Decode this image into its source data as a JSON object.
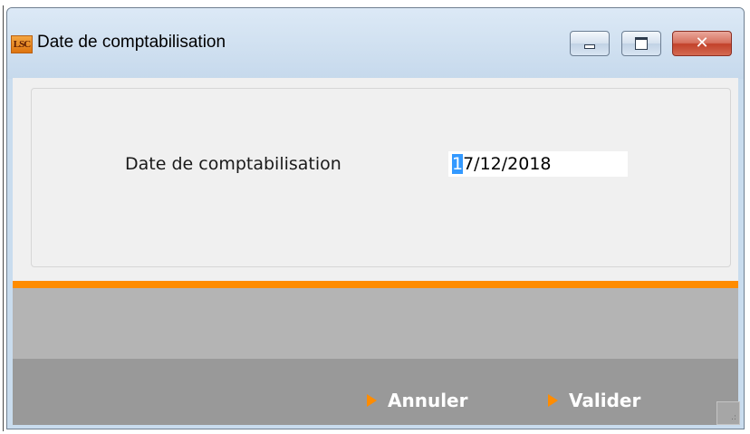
{
  "window": {
    "app_icon_text": "LSC",
    "title": "Date de comptabilisation",
    "controls": {
      "minimize": "minimize-icon",
      "maximize": "maximize-icon",
      "close": "close-icon",
      "close_glyph": "✕"
    }
  },
  "form": {
    "date_label": "Date de comptabilisation",
    "date_value": "17/12/2018",
    "date_selected_char": "1",
    "date_rest": "7/12/2018"
  },
  "actions": {
    "cancel_label": "Annuler",
    "ok_label": "Valider"
  },
  "colors": {
    "accent": "#ff8c00",
    "footer_light": "#b4b4b4",
    "footer_dark": "#999999",
    "content_bg": "#f0f0f0"
  }
}
